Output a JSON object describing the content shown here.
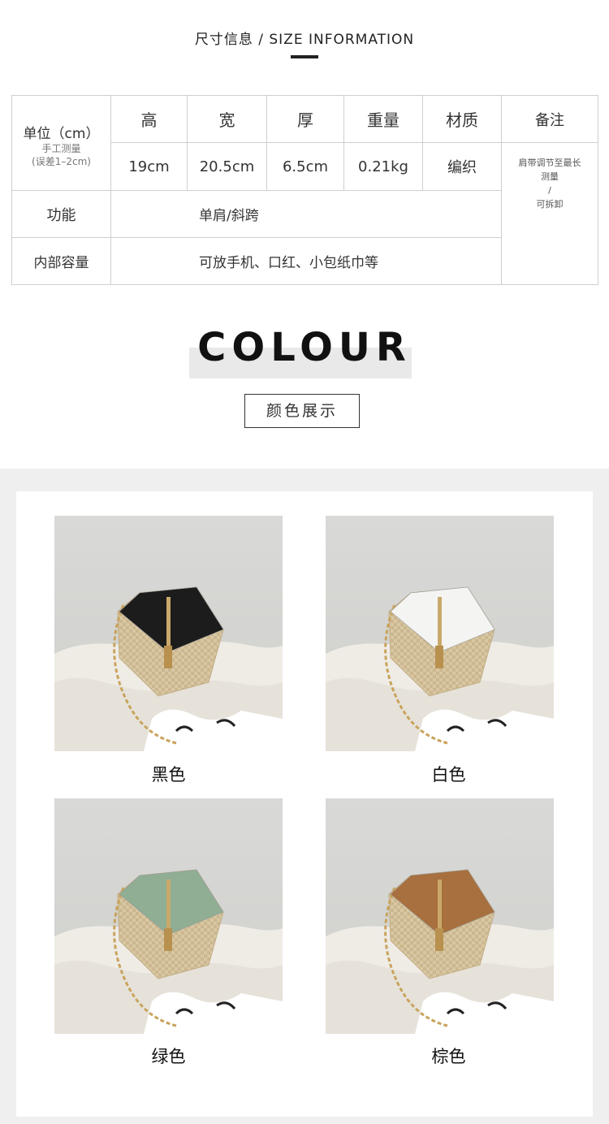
{
  "size_section": {
    "title": "尺寸信息 / SIZE INFORMATION",
    "unit_label": "单位（cm）",
    "unit_note_1": "手工测量",
    "unit_note_2": "(误差1–2cm)",
    "headers": [
      "高",
      "宽",
      "厚",
      "重量",
      "材质",
      "备注"
    ],
    "values": [
      "19cm",
      "20.5cm",
      "6.5cm",
      "0.21kg",
      "编织"
    ],
    "note_lines": [
      "肩带调节至最长",
      "测量",
      "/",
      "可拆卸"
    ],
    "function_label": "功能",
    "function_value": "单肩/斜跨",
    "capacity_label": "内部容量",
    "capacity_value": "可放手机、口红、小包纸巾等"
  },
  "colour_section": {
    "title": "COLOUR",
    "button_label": "颜色展示"
  },
  "variants": [
    {
      "label": "黑色",
      "flap_color": "#1c1c1c"
    },
    {
      "label": "白色",
      "flap_color": "#f4f4f2"
    },
    {
      "label": "绿色",
      "flap_color": "#8fae94"
    },
    {
      "label": "棕色",
      "flap_color": "#a8703e"
    }
  ]
}
